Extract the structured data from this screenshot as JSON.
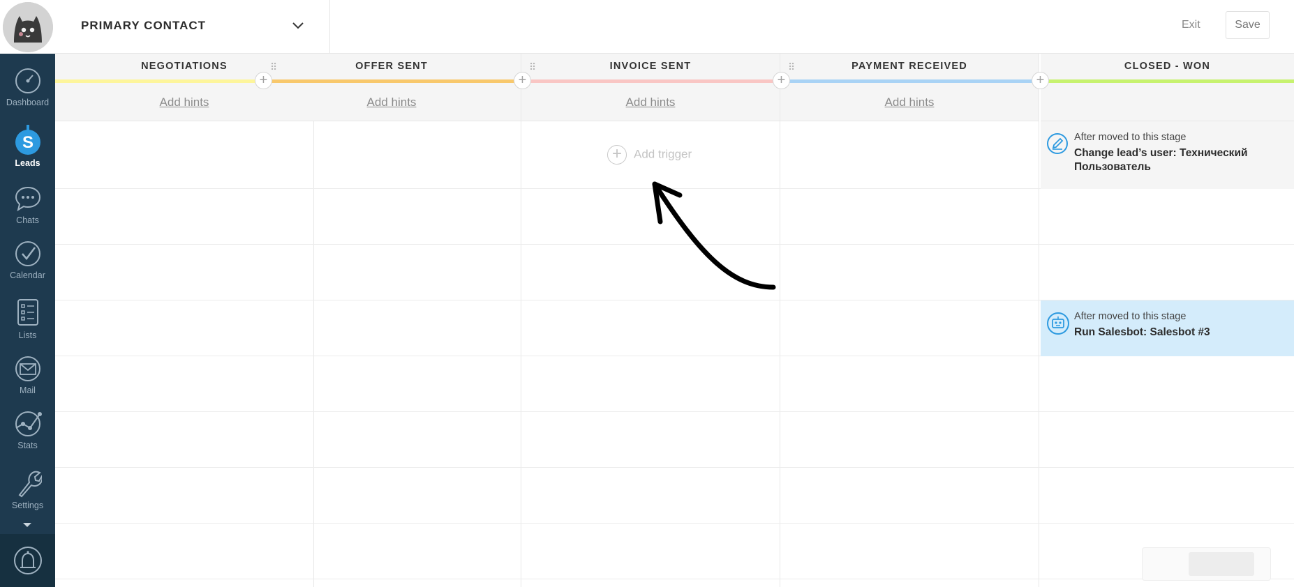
{
  "header": {
    "contact_label": "PRIMARY CONTACT",
    "exit_label": "Exit",
    "save_label": "Save"
  },
  "sidebar": {
    "items": [
      {
        "label": "Dashboard",
        "icon": "dashboard-icon"
      },
      {
        "label": "Leads",
        "icon": "leads-icon"
      },
      {
        "label": "Chats",
        "icon": "chats-icon"
      },
      {
        "label": "Calendar",
        "icon": "calendar-icon"
      },
      {
        "label": "Lists",
        "icon": "lists-icon"
      },
      {
        "label": "Mail",
        "icon": "mail-icon"
      },
      {
        "label": "Stats",
        "icon": "stats-icon"
      },
      {
        "label": "Settings",
        "icon": "settings-icon"
      }
    ],
    "bell_icon": "bell-icon"
  },
  "stages": [
    {
      "title": "NEGOTIATIONS",
      "color": "#fdf59b",
      "hint": "Add hints"
    },
    {
      "title": "OFFER SENT",
      "color": "#f8c86c",
      "hint": "Add hints"
    },
    {
      "title": "INVOICE SENT",
      "color": "#f9c6c4",
      "hint": "Add hints"
    },
    {
      "title": "PAYMENT RECEIVED",
      "color": "#a9d3f5",
      "hint": "Add hints"
    },
    {
      "title": "CLOSED - WON",
      "color": "#c7f26f",
      "hint": ""
    }
  ],
  "board": {
    "add_trigger_label": "Add trigger",
    "triggers": [
      {
        "pre": "After moved to this stage",
        "action": "Change lead’s user: Технический Пользователь",
        "icon": "edit-icon"
      },
      {
        "pre": "After moved to this stage",
        "action": "Run Salesbot: Salesbot #3",
        "icon": "robot-icon"
      }
    ]
  },
  "colors": {
    "sidebar": "#1e3a4f",
    "accent": "#2d9ae0",
    "highlight": "#d4ecfb"
  }
}
